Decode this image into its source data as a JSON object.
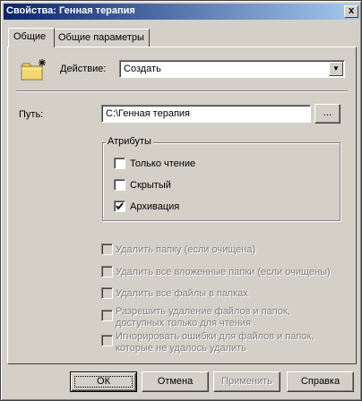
{
  "window": {
    "title": "Свойства: Генная терапия",
    "close_glyph": "x"
  },
  "tabs": [
    {
      "label": "Общие",
      "active": true
    },
    {
      "label": "Общие параметры",
      "active": false
    }
  ],
  "action": {
    "label": "Действие:",
    "value": "Создать"
  },
  "path": {
    "label": "Путь:",
    "value": "C:\\Генная терапия",
    "browse_label": "..."
  },
  "attributes": {
    "title": "Атрибуты",
    "items": [
      {
        "label": "Только чтение",
        "checked": false
      },
      {
        "label": "Скрытый",
        "checked": false
      },
      {
        "label": "Архивация",
        "checked": true
      }
    ]
  },
  "options": [
    {
      "label": "Удалить папку (если очищена)",
      "checked": false,
      "enabled": false
    },
    {
      "label": "Удалить все вложенные папки (если очищены)",
      "checked": false,
      "enabled": false
    },
    {
      "label": "Удалить все файлы в папках",
      "checked": false,
      "enabled": false
    },
    {
      "label": "Разрешить удаление файлов и папок,",
      "label2": "доступных только для чтения",
      "checked": false,
      "enabled": false
    },
    {
      "label": "Игнорировать ошибки для файлов и папок,",
      "label2": "которые не удалось удалить",
      "checked": false,
      "enabled": false
    }
  ],
  "buttons": {
    "ok": "ОК",
    "cancel": "Отмена",
    "apply": "Применить",
    "help": "Справка"
  },
  "icons": {
    "folder": "new-folder-icon",
    "dropdown": "chevron-down-icon"
  },
  "colors": {
    "title_start": "#0a246a",
    "title_end": "#a6caf0",
    "face": "#d4d0c8",
    "disabled_text": "#808080"
  }
}
